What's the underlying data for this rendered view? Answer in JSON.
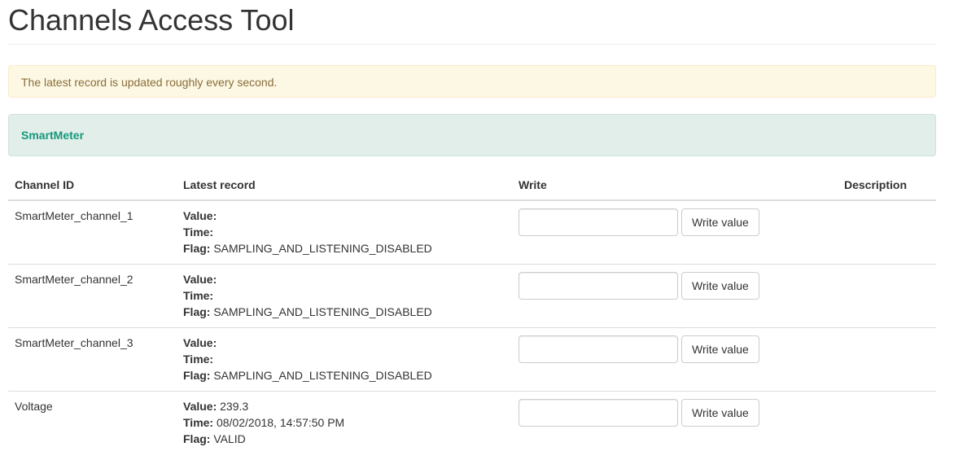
{
  "page": {
    "title": "Channels Access Tool",
    "notice": "The latest record is updated roughly every second."
  },
  "device": {
    "name": "SmartMeter"
  },
  "table": {
    "headers": {
      "channel_id": "Channel ID",
      "latest_record": "Latest record",
      "write": "Write",
      "description": "Description"
    },
    "labels": {
      "value": "Value:",
      "time": "Time:",
      "flag": "Flag:"
    },
    "write_button_label": "Write value",
    "rows": [
      {
        "id": "SmartMeter_channel_1",
        "value": "",
        "time": "",
        "flag": "SAMPLING_AND_LISTENING_DISABLED",
        "input_value": "",
        "description": ""
      },
      {
        "id": "SmartMeter_channel_2",
        "value": "",
        "time": "",
        "flag": "SAMPLING_AND_LISTENING_DISABLED",
        "input_value": "",
        "description": ""
      },
      {
        "id": "SmartMeter_channel_3",
        "value": "",
        "time": "",
        "flag": "SAMPLING_AND_LISTENING_DISABLED",
        "input_value": "",
        "description": ""
      },
      {
        "id": "Voltage",
        "value": "239.3",
        "time": "08/02/2018, 14:57:50 PM",
        "flag": "VALID",
        "input_value": "",
        "description": ""
      }
    ]
  },
  "colors": {
    "notice_bg": "#fcf8e3",
    "notice_text": "#8a6d3b",
    "device_bg": "#e1eeea",
    "device_text": "#16987a"
  }
}
